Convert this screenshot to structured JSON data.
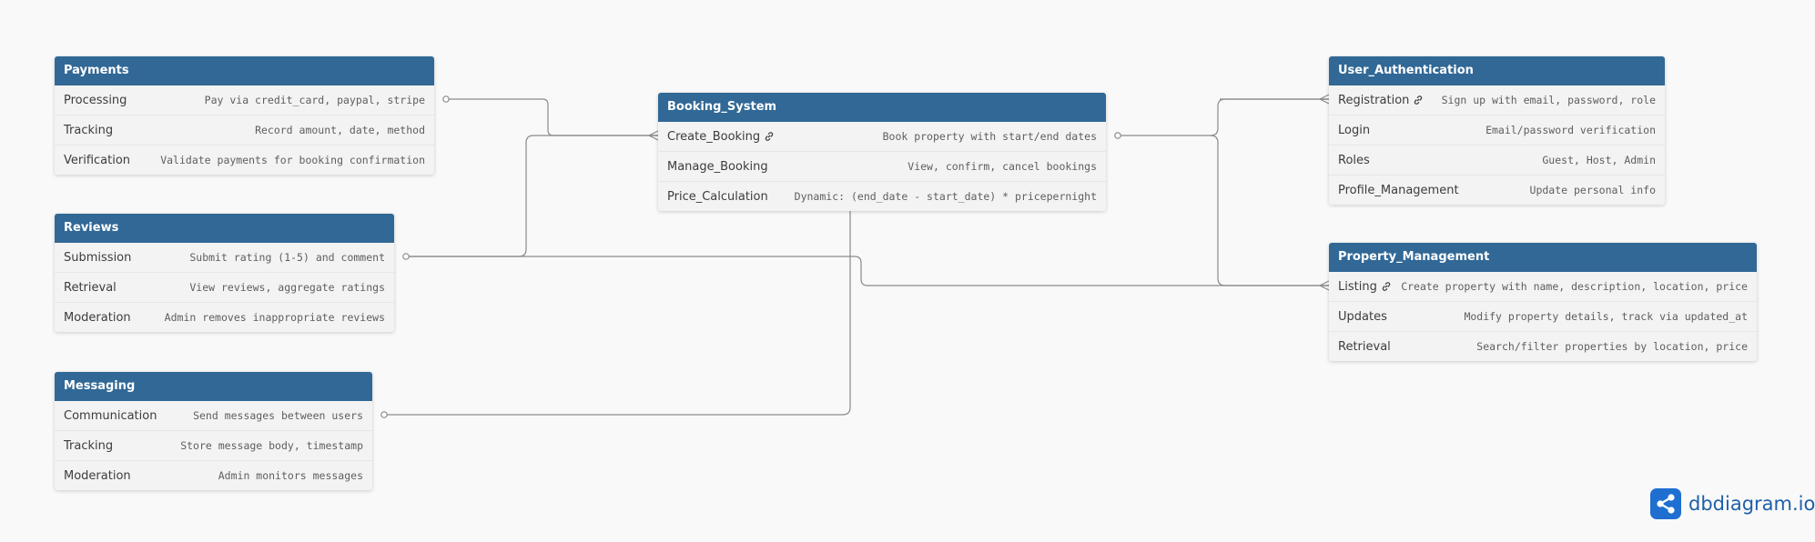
{
  "colors": {
    "header_bg": "#316896",
    "header_text": "#ffffff",
    "row_bg": "#f3f3f3",
    "connector": "#8a8a8a",
    "brand": "#1f5fa8"
  },
  "tables": {
    "payments": {
      "name": "Payments",
      "fields": [
        {
          "name": "Processing",
          "desc": "Pay via credit_card, paypal, stripe",
          "ref": false
        },
        {
          "name": "Tracking",
          "desc": "Record amount, date, method",
          "ref": false
        },
        {
          "name": "Verification",
          "desc": "Validate payments for booking confirmation",
          "ref": false
        }
      ]
    },
    "reviews": {
      "name": "Reviews",
      "fields": [
        {
          "name": "Submission",
          "desc": "Submit rating (1-5) and comment",
          "ref": false
        },
        {
          "name": "Retrieval",
          "desc": "View reviews, aggregate ratings",
          "ref": false
        },
        {
          "name": "Moderation",
          "desc": "Admin removes inappropriate reviews",
          "ref": false
        }
      ]
    },
    "messaging": {
      "name": "Messaging",
      "fields": [
        {
          "name": "Communication",
          "desc": "Send messages between users",
          "ref": false
        },
        {
          "name": "Tracking",
          "desc": "Store message body, timestamp",
          "ref": false
        },
        {
          "name": "Moderation",
          "desc": "Admin monitors messages",
          "ref": false
        }
      ]
    },
    "booking_system": {
      "name": "Booking_System",
      "fields": [
        {
          "name": "Create_Booking",
          "desc": "Book property with start/end dates",
          "ref": true
        },
        {
          "name": "Manage_Booking",
          "desc": "View, confirm, cancel bookings",
          "ref": false
        },
        {
          "name": "Price_Calculation",
          "desc": "Dynamic: (end_date - start_date) * pricepernight",
          "ref": false
        }
      ]
    },
    "user_authentication": {
      "name": "User_Authentication",
      "fields": [
        {
          "name": "Registration",
          "desc": "Sign up with email, password, role",
          "ref": true
        },
        {
          "name": "Login",
          "desc": "Email/password verification",
          "ref": false
        },
        {
          "name": "Roles",
          "desc": "Guest, Host, Admin",
          "ref": false
        },
        {
          "name": "Profile_Management",
          "desc": "Update personal info",
          "ref": false
        }
      ]
    },
    "property_management": {
      "name": "Property_Management",
      "fields": [
        {
          "name": "Listing",
          "desc": "Create property with name, description, location, price",
          "ref": true
        },
        {
          "name": "Updates",
          "desc": "Modify property details, track via updated_at",
          "ref": false
        },
        {
          "name": "Retrieval",
          "desc": "Search/filter properties by location, price",
          "ref": false
        }
      ]
    }
  },
  "relationships": [
    {
      "name": "payments-to-booking",
      "from": "Payments.Processing",
      "to": "Booking_System.Create_Booking"
    },
    {
      "name": "reviews-to-booking",
      "from": "Reviews.Submission",
      "to": "Booking_System.Create_Booking"
    },
    {
      "name": "booking-to-user",
      "from": "Booking_System.Create_Booking",
      "to": "User_Authentication.Registration"
    },
    {
      "name": "booking-to-property",
      "from": "Booking_System.Create_Booking",
      "to": "Property_Management.Listing"
    },
    {
      "name": "user-to-property",
      "from": "User_Authentication.Registration",
      "to": "Property_Management.Listing"
    },
    {
      "name": "reviews-to-property",
      "from": "Reviews.Submission",
      "to": "Property_Management.Listing"
    },
    {
      "name": "messaging-to-user",
      "from": "Messaging.Communication",
      "to": "User_Authentication.Registration"
    }
  ],
  "brand": {
    "icon": "share-nodes-icon",
    "text": "dbdiagram.io"
  }
}
